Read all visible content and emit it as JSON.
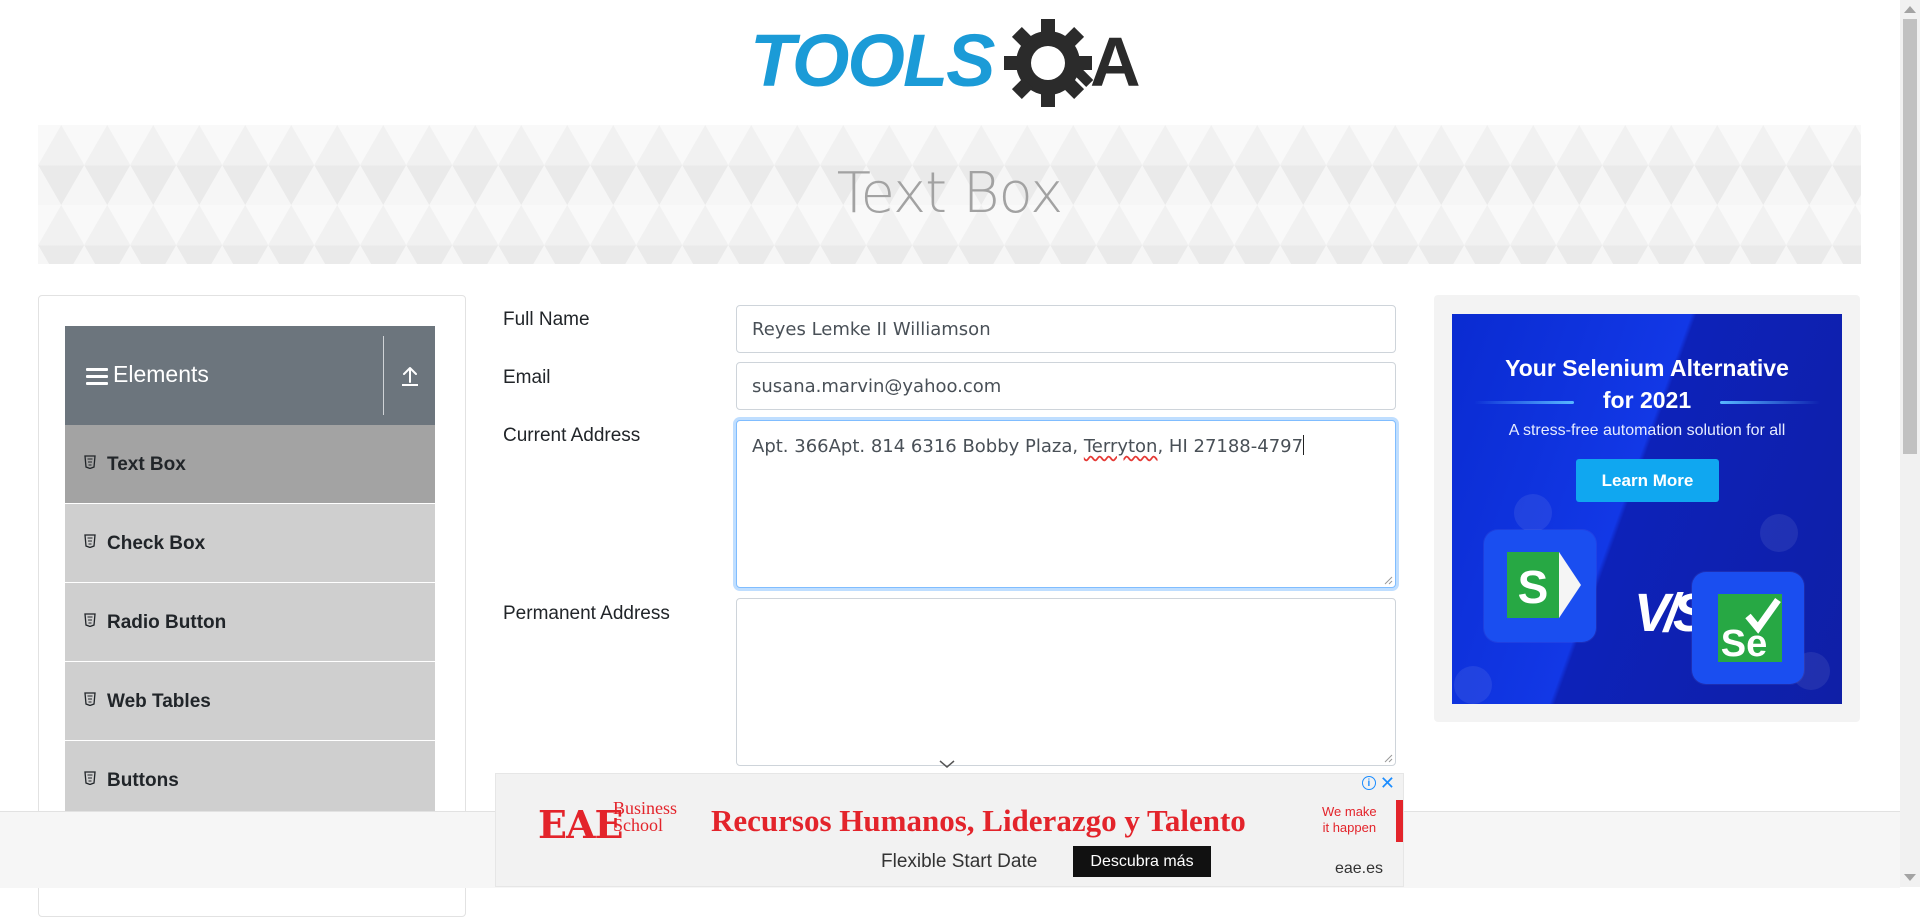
{
  "brand": {
    "logo_text": "TOOLSQA"
  },
  "banner": {
    "title": "Text Box"
  },
  "sidebar": {
    "group": {
      "title": "Elements",
      "toggle_icon": "collapse-up-icon"
    },
    "items": [
      {
        "label": "Text Box",
        "active": true
      },
      {
        "label": "Check Box"
      },
      {
        "label": "Radio Button"
      },
      {
        "label": "Web Tables"
      },
      {
        "label": "Buttons"
      }
    ]
  },
  "form": {
    "full_name": {
      "label": "Full Name",
      "value": "Reyes Lemke II Williamson"
    },
    "email": {
      "label": "Email",
      "value": "susana.marvin@yahoo.com"
    },
    "current_address": {
      "label": "Current Address",
      "value_before": "Apt. 366Apt. 814 6316 Bobby Plaza, ",
      "value_misspelled": "Terryton",
      "value_after": ", HI 27188-4797"
    },
    "permanent_address": {
      "label": "Permanent Address",
      "value": ""
    }
  },
  "right_ad": {
    "title_line1": "Your Selenium Alternative",
    "title_line2": "for 2021",
    "subtitle": "A stress-free automation solution for all",
    "button": "Learn More",
    "left_logo": "S",
    "vs": "VS",
    "right_logo": "Se"
  },
  "bottom_ad": {
    "logo": "EAE",
    "school_line1": "Business",
    "school_line2": "School",
    "headline": "Recursos Humanos, Liderazgo y Talento",
    "tag_line1": "We make",
    "tag_line2": "it happen",
    "subline": "Flexible Start Date",
    "cta": "Descubra más",
    "domain": "eae.es"
  },
  "colors": {
    "sidebar_header": "#6c757d",
    "menu_item": "#cfcfcf",
    "menu_item_active": "#a3a3a3",
    "logo_blue": "#1b9bd7",
    "logo_dark": "#2b2b2b",
    "ad_blue": "#1238e6",
    "eae_red": "#e3242b"
  }
}
